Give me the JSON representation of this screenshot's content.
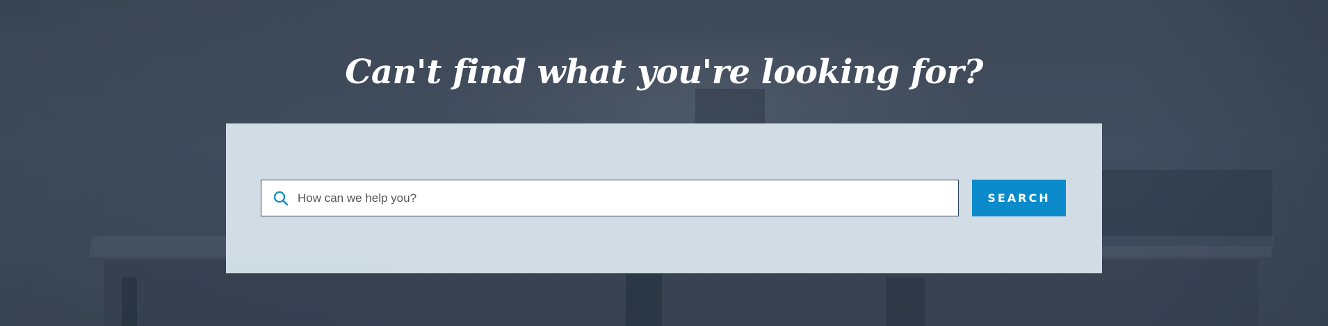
{
  "headline": "Can't find what you're looking for?",
  "search": {
    "placeholder": "How can we help you?",
    "value": "",
    "icon": "search-icon",
    "button_label": "SEARCH",
    "button_color": "#0b8bcb",
    "icon_color": "#1a8fc2"
  }
}
